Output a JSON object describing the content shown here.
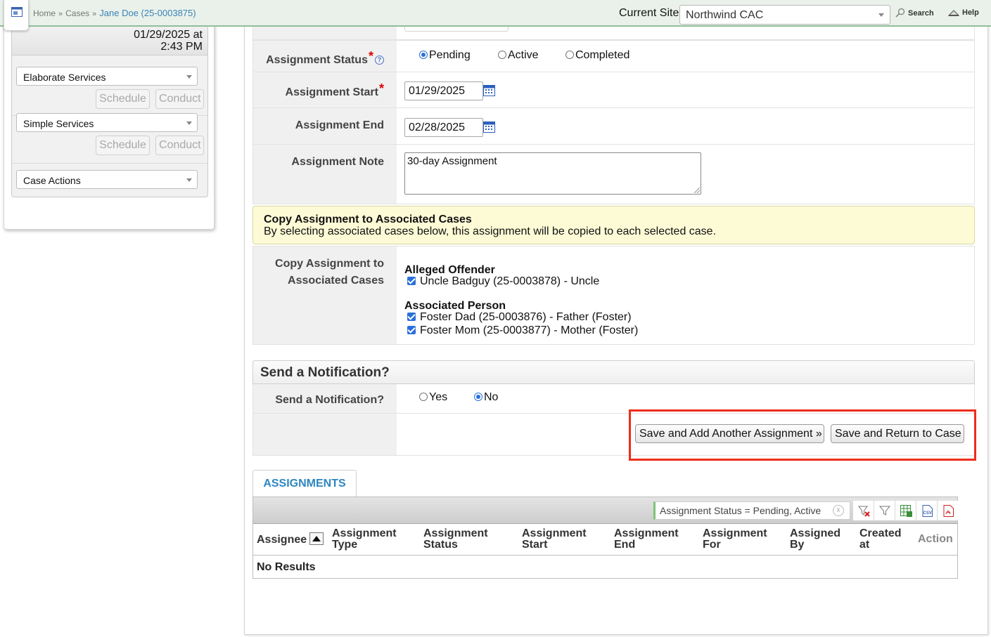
{
  "breadcrumb": {
    "home": "Home",
    "cases": "Cases",
    "current": "Jane Doe (25-0003875)"
  },
  "site": {
    "label": "Current Site",
    "value": "Northwind CAC"
  },
  "top_links": {
    "search": "Search",
    "help": "Help"
  },
  "left_panel": {
    "date_line1": "01/29/2025 at",
    "date_line2": "2:43 PM",
    "elaborate_select": "Elaborate Services",
    "simple_select": "Simple Services",
    "case_actions_select": "Case Actions",
    "schedule_label": "Schedule",
    "conduct_label": "Conduct"
  },
  "form": {
    "status": {
      "label": "Assignment Status",
      "required_mark": "*",
      "help_mark": "?",
      "options": [
        "Pending",
        "Active",
        "Completed"
      ],
      "selected": "Pending"
    },
    "start": {
      "label": "Assignment Start",
      "required_mark": "*",
      "value": "01/29/2025"
    },
    "end": {
      "label": "Assignment End",
      "value": "02/28/2025"
    },
    "note": {
      "label": "Assignment Note",
      "value": "30-day Assignment"
    }
  },
  "copy_box": {
    "title": "Copy Assignment to Associated Cases",
    "description": "By selecting associated cases below, this assignment will be copied to each selected case."
  },
  "copy_field": {
    "label_line1": "Copy Assignment to",
    "label_line2": "Associated Cases",
    "groups": [
      {
        "heading": "Alleged Offender",
        "items": [
          "Uncle Badguy (25-0003878) - Uncle"
        ]
      },
      {
        "heading": "Associated Person",
        "items": [
          "Foster Dad (25-0003876) - Father (Foster)",
          "Foster Mom (25-0003877) - Mother (Foster)"
        ]
      }
    ]
  },
  "notification": {
    "section_title": "Send a Notification?",
    "label": "Send a Notification?",
    "options": [
      "Yes",
      "No"
    ],
    "selected": "No"
  },
  "buttons": {
    "save_add": "Save and Add Another Assignment »",
    "save_return": "Save and Return to Case"
  },
  "assignments": {
    "tab_label": "ASSIGNMENTS",
    "filter_chip": "Assignment Status = Pending, Active",
    "filter_clear": "x",
    "columns": [
      [
        "Assignee"
      ],
      [
        "Assignment",
        "Type"
      ],
      [
        "Assignment",
        "Status"
      ],
      [
        "Assignment",
        "Start"
      ],
      [
        "Assignment",
        "End"
      ],
      [
        "Assignment",
        "For"
      ],
      [
        "Assigned",
        "By"
      ],
      [
        "Created",
        "at"
      ],
      [
        "Action"
      ]
    ],
    "empty_text": "No Results",
    "tool_icons": [
      "clear-filter-icon",
      "filter-icon",
      "excel-export-icon",
      "csv-export-icon",
      "pdf-export-icon"
    ]
  },
  "colors": {
    "topbar_bg": "#e9f1ea",
    "link_blue": "#3a83b7",
    "highlight_red": "#ee2c1a",
    "notice_yellow": "#fdfbd6",
    "radio_blue": "#2a6fd9"
  }
}
